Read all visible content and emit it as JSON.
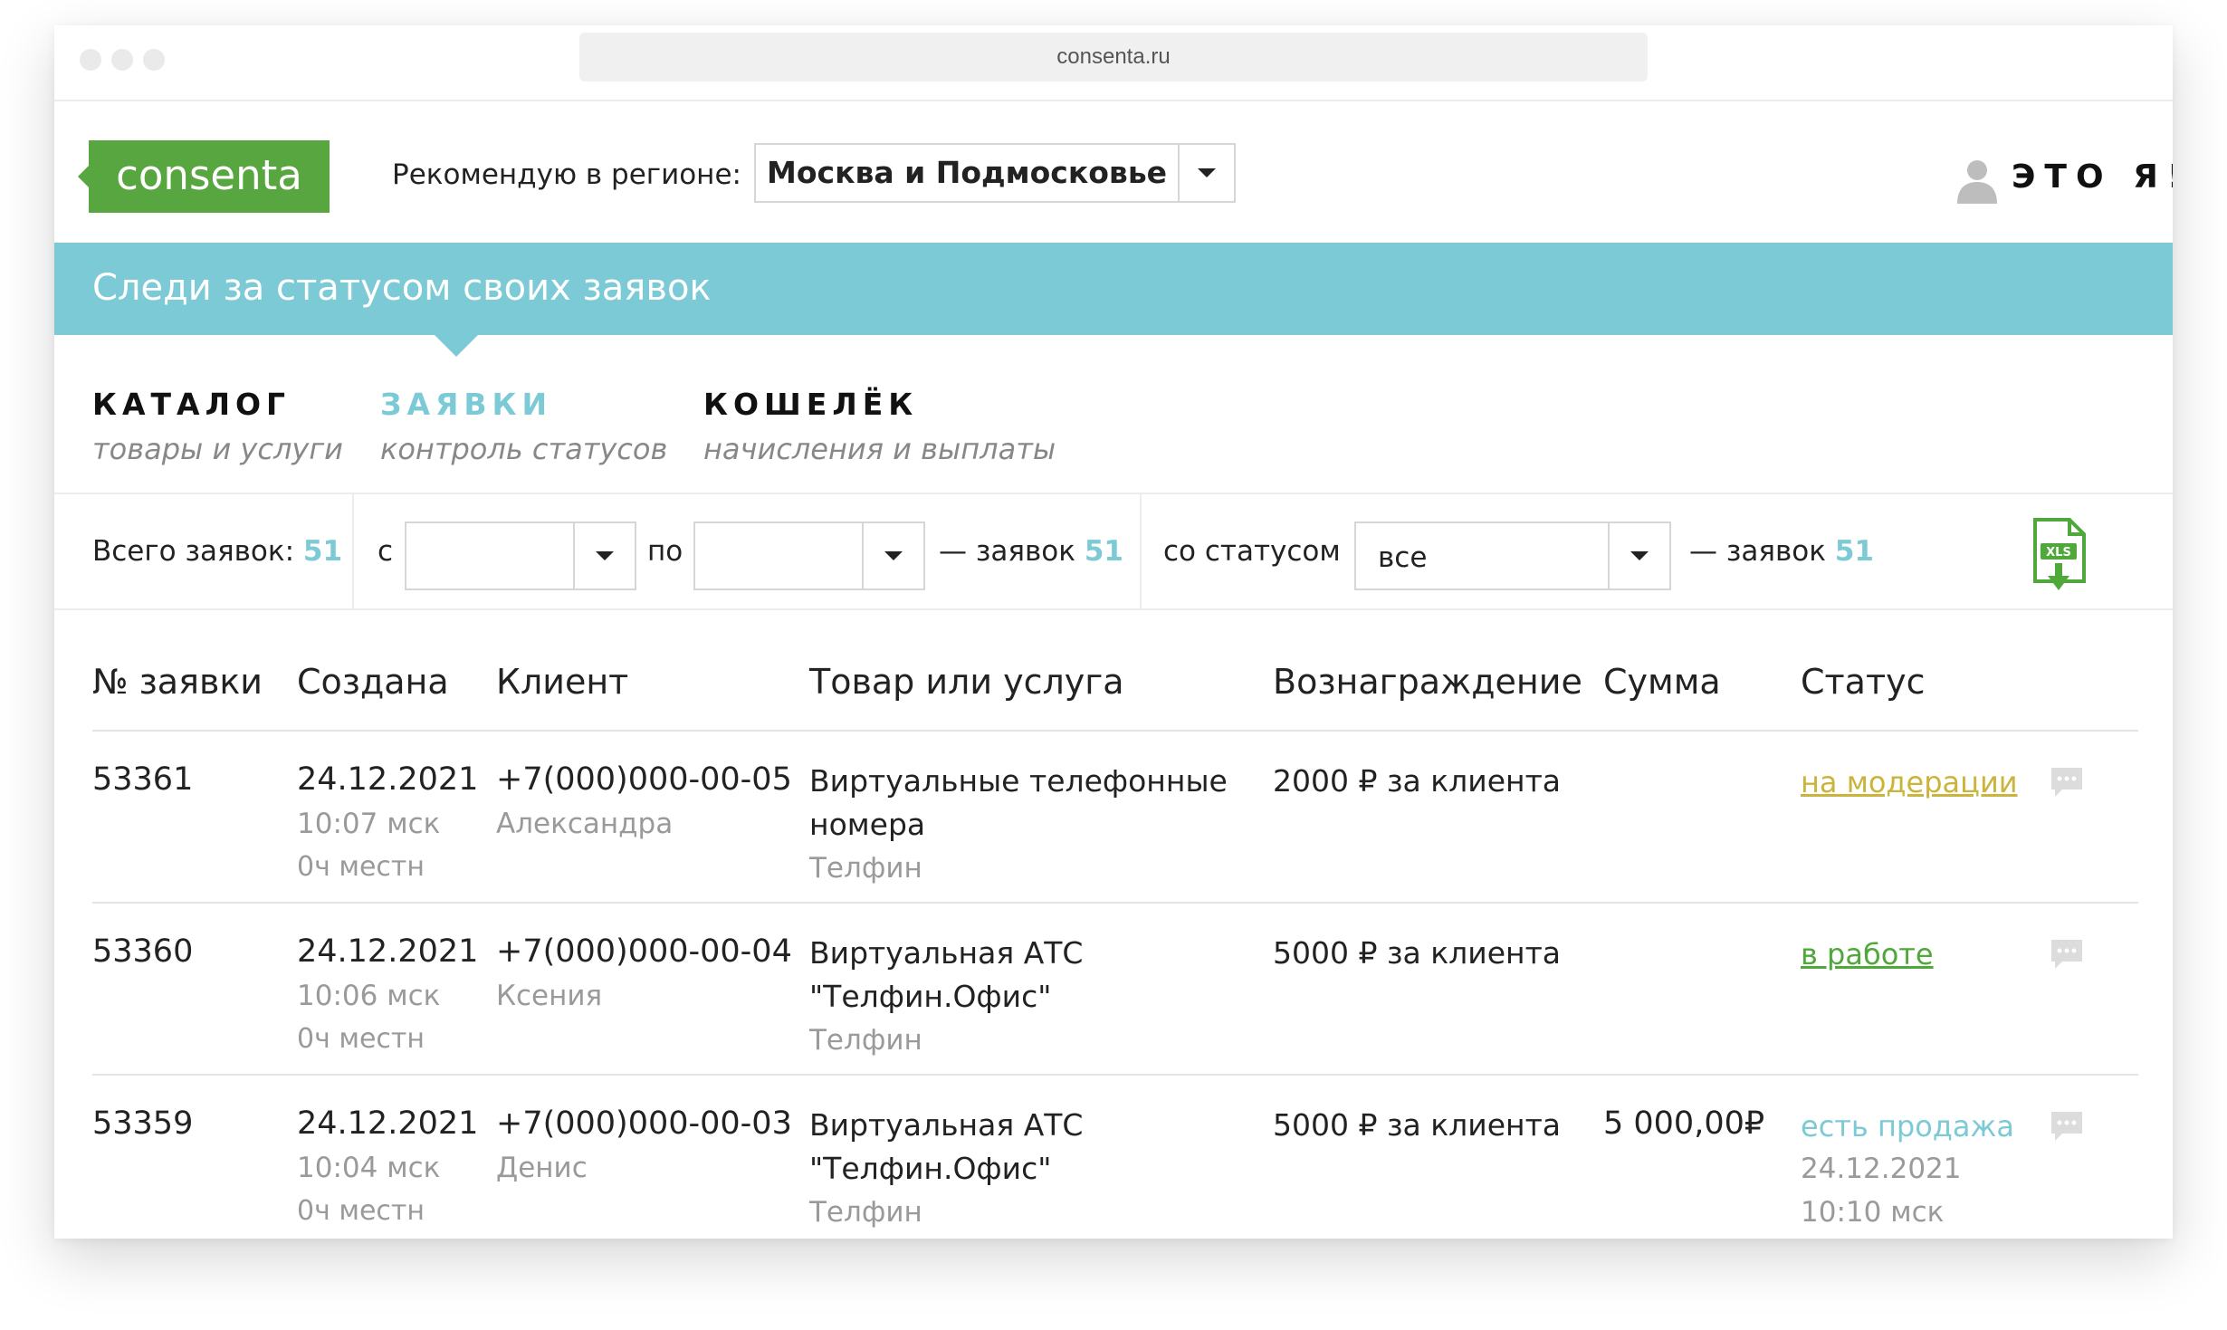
{
  "browser": {
    "url": "consenta.ru"
  },
  "header": {
    "logo_text": "consenta",
    "region_label": "Рекомендую в регионе:",
    "region_value": "Москва и Подмосковье",
    "user_label": "ЭТО Я!"
  },
  "banner": {
    "title": "Следи за статусом своих заявок"
  },
  "nav": [
    {
      "title": "КАТАЛОГ",
      "subtitle": "товары и услуги"
    },
    {
      "title": "ЗАЯВКИ",
      "subtitle": "контроль статусов"
    },
    {
      "title": "КОШЕЛЁК",
      "subtitle": "начисления и выплаты"
    }
  ],
  "filters": {
    "total_label": "Всего заявок:",
    "total_count": "51",
    "from_label": "с",
    "from_value": "",
    "to_label": "по",
    "to_value": "",
    "range_result_label": "— заявок",
    "range_result_count": "51",
    "status_label": "со статусом",
    "status_value": "все",
    "status_result_label": "— заявок",
    "status_result_count": "51",
    "export_icon": "xls-download-icon"
  },
  "table": {
    "headers": [
      "№ заявки",
      "Создана",
      "Клиент",
      "Товар или услуга",
      "Вознаграждение",
      "Сумма",
      "Статус"
    ],
    "rows": [
      {
        "id": "53361",
        "date": "24.12.2021",
        "time": "10:07 мск",
        "local_time": "0ч местн",
        "phone": "+7(000)000-00-05",
        "client_name": "Александра",
        "product_line1": "Виртуальные телефонные",
        "product_line2": "номера",
        "vendor": "Телфин",
        "reward": "2000 ₽ за клиента",
        "sum": "",
        "status": "на модерации",
        "status_date": "",
        "status_time": ""
      },
      {
        "id": "53360",
        "date": "24.12.2021",
        "time": "10:06 мск",
        "local_time": "0ч местн",
        "phone": "+7(000)000-00-04",
        "client_name": "Ксения",
        "product_line1": "Виртуальная АТС",
        "product_line2": "\"Телфин.Офис\"",
        "vendor": "Телфин",
        "reward": "5000 ₽ за клиента",
        "sum": "",
        "status": "в работе",
        "status_date": "",
        "status_time": ""
      },
      {
        "id": "53359",
        "date": "24.12.2021",
        "time": "10:04 мск",
        "local_time": "0ч местн",
        "phone": "+7(000)000-00-03",
        "client_name": "Денис",
        "product_line1": "Виртуальная АТС",
        "product_line2": "\"Телфин.Офис\"",
        "vendor": "Телфин",
        "reward": "5000 ₽ за клиента",
        "sum": "5 000,00₽",
        "status": "есть продажа",
        "status_date": "24.12.2021",
        "status_time": "10:10 мск"
      }
    ]
  },
  "colors": {
    "brand_green": "#58a63f",
    "accent_teal": "#7ccad6",
    "status_moderation": "#cbb43c",
    "status_work": "#4fa83a"
  }
}
